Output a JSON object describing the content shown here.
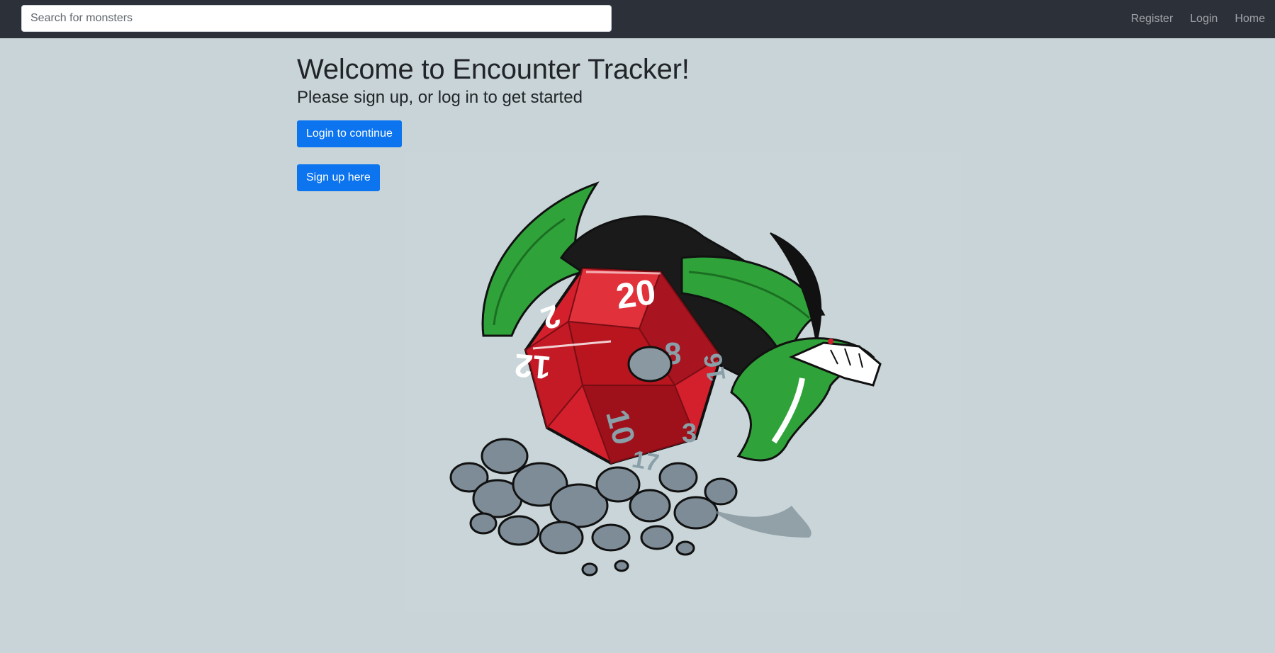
{
  "navbar": {
    "search": {
      "placeholder": "Search for monsters",
      "value": ""
    },
    "links": [
      {
        "label": "Register"
      },
      {
        "label": "Login"
      },
      {
        "label": "Home"
      }
    ]
  },
  "main": {
    "title": "Welcome to Encounter Tracker!",
    "subtitle": "Please sign up, or log in to get started",
    "login_button": "Login to continue",
    "signup_button": "Sign up here"
  },
  "hero": {
    "die_faces": [
      "20",
      "2",
      "12",
      "8",
      "16",
      "10",
      "3",
      "17"
    ]
  },
  "colors": {
    "navbar_bg": "#2c3039",
    "page_bg": "#c8d4d7",
    "button_primary": "#0b74ee",
    "die_red": "#d4202c",
    "dragon_green": "#2fa33a"
  },
  "icons": {
    "hero_image": "d20-dragon-illustration"
  }
}
